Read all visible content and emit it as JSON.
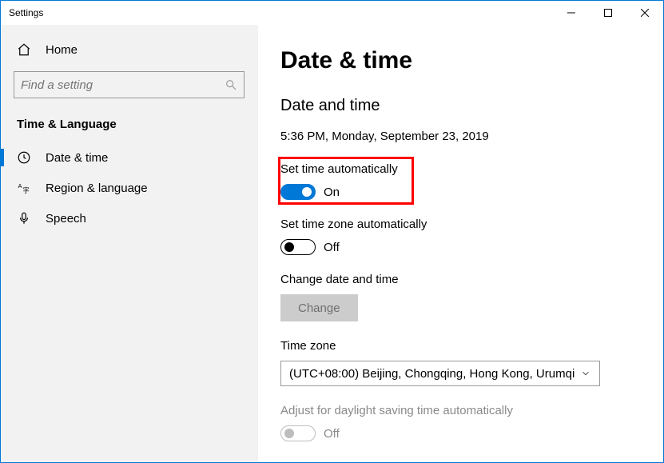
{
  "window": {
    "title": "Settings"
  },
  "sidebar": {
    "home_label": "Home",
    "search_placeholder": "Find a setting",
    "section_title": "Time & Language",
    "items": [
      {
        "label": "Date & time"
      },
      {
        "label": "Region & language"
      },
      {
        "label": "Speech"
      }
    ]
  },
  "main": {
    "heading": "Date & time",
    "subheading": "Date and time",
    "current_time": "5:36 PM, Monday, September 23, 2019",
    "set_time_auto": {
      "label": "Set time automatically",
      "state": "On"
    },
    "set_tz_auto": {
      "label": "Set time zone automatically",
      "state": "Off"
    },
    "change_dt": {
      "label": "Change date and time",
      "button": "Change"
    },
    "timezone": {
      "label": "Time zone",
      "value": "(UTC+08:00) Beijing, Chongqing, Hong Kong, Urumqi"
    },
    "dst": {
      "label": "Adjust for daylight saving time automatically",
      "state": "Off"
    }
  }
}
